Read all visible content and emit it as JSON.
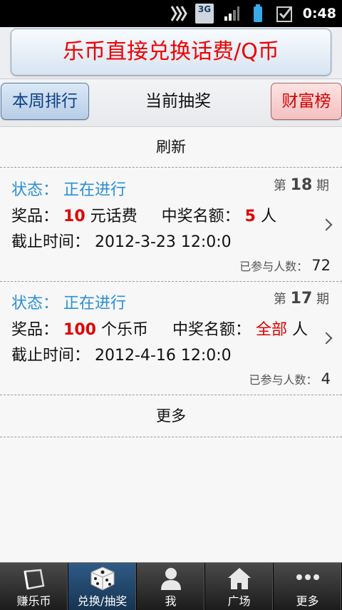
{
  "status_bar": {
    "network": "3G",
    "time": "0:48"
  },
  "banner": {
    "exchange_label": "乐币直接兑换话费/Q币"
  },
  "tabs": {
    "weekly_rank": "本周排行",
    "current_title": "当前抽奖",
    "wealth_rank": "财富榜"
  },
  "refresh_label": "刷新",
  "labels": {
    "status": "状态：",
    "prize": "奖品：",
    "winners": "中奖名额：",
    "deadline": "截止时间：",
    "participants": "已参与人数：",
    "period_prefix": "第",
    "period_suffix": "期"
  },
  "draws": [
    {
      "status": "正在进行",
      "period": "18",
      "prize_amount": "10",
      "prize_unit": "元话费",
      "winners_count": "5",
      "winners_unit": "人",
      "deadline": "2012-3-23 12:0:0",
      "participants": "72"
    },
    {
      "status": "正在进行",
      "period": "17",
      "prize_amount": "100",
      "prize_unit": "个乐币",
      "winners_count": "全部",
      "winners_unit": "人",
      "deadline": "2012-4-16 12:0:0",
      "participants": "4"
    }
  ],
  "more_label": "更多",
  "bottom_nav": [
    {
      "label": "赚乐币",
      "icon": "folder-icon"
    },
    {
      "label": "兑换/抽奖",
      "icon": "dice-icon",
      "active": true
    },
    {
      "label": "我",
      "icon": "person-icon"
    },
    {
      "label": "广场",
      "icon": "house-icon"
    },
    {
      "label": "更多",
      "icon": "dots-icon"
    }
  ],
  "colors": {
    "accent_red": "#e00000",
    "status_blue": "#2a8fd6",
    "nav_active": "#2f5b86"
  }
}
